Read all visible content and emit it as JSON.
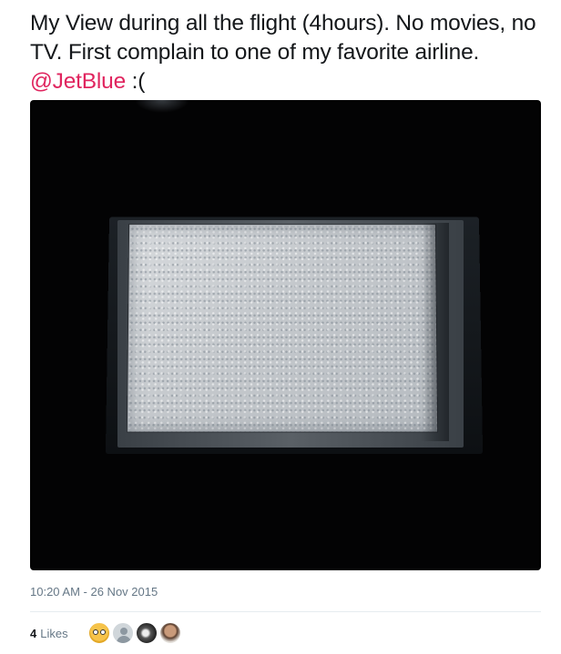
{
  "tweet": {
    "text_before": "My View during all the flight (4hours). No movies, no TV. First complain to one of my favorite airline.",
    "mention": "@JetBlue",
    "text_after": ":("
  },
  "timestamp": "10:20 AM - 26 Nov 2015",
  "likes": {
    "count": "4",
    "label": "Likes",
    "avatars": [
      "avatar-yellow-cartoon",
      "avatar-default",
      "avatar-dark-photo",
      "avatar-person-photo"
    ]
  },
  "colors": {
    "mention": "#e0245e",
    "meta_text": "#657786",
    "body_text": "#14171a"
  }
}
